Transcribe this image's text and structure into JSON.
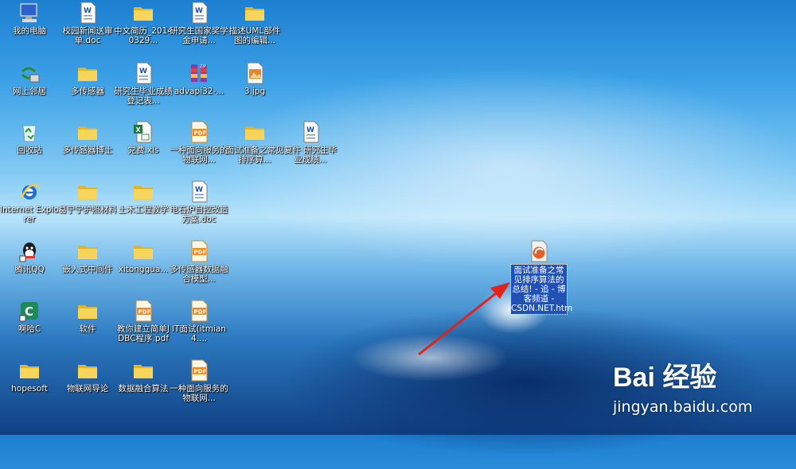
{
  "desktop": {
    "icons": [
      {
        "label": "我的电脑",
        "icon": "computer-icon"
      },
      {
        "label": "校园新闻送审单.doc",
        "icon": "word-doc-icon"
      },
      {
        "label": "中文简历_20140329...",
        "icon": "folder-icon"
      },
      {
        "label": "研究生国家奖学金申请...",
        "icon": "word-doc-icon"
      },
      {
        "label": "描述UML部件图的编辑...",
        "icon": "folder-icon"
      },
      {
        "label": "网上邻居",
        "icon": "network-icon"
      },
      {
        "label": "多传感器",
        "icon": "folder-icon"
      },
      {
        "label": "研究生毕业成绩登记表...",
        "icon": "word-doc-icon"
      },
      {
        "label": "advapi32-...",
        "icon": "winrar-icon"
      },
      {
        "label": "3.jpg",
        "icon": "image-icon"
      },
      {
        "label": "回收站",
        "icon": "recycle-bin-icon"
      },
      {
        "label": "多传感器博士",
        "icon": "folder-icon"
      },
      {
        "label": "党费.xls",
        "icon": "excel-icon"
      },
      {
        "label": "一种面向服务的物联网...",
        "icon": "pdf-icon"
      },
      {
        "label": "面试准备之常见排序算...",
        "icon": "folder-icon"
      },
      {
        "label": "复件 研究生毕业成绩...",
        "icon": "word-doc-icon"
      },
      {
        "label": "Internet Explorer",
        "icon": "ie-icon"
      },
      {
        "label": "葛宁宁护照材料",
        "icon": "folder-icon"
      },
      {
        "label": "土木工程教学",
        "icon": "folder-icon"
      },
      {
        "label": "电石炉自控改造方案.doc",
        "icon": "word-doc-icon"
      },
      {
        "label": "腾讯QQ",
        "icon": "qq-icon"
      },
      {
        "label": "嵌入式中间件",
        "icon": "folder-icon"
      },
      {
        "label": "xitonggua...",
        "icon": "folder-icon"
      },
      {
        "label": "多传感器数据融合模型...",
        "icon": "pdf-icon"
      },
      {
        "label": "啊哈C",
        "icon": "aha-c-icon"
      },
      {
        "label": "软件",
        "icon": "folder-icon"
      },
      {
        "label": "教你建立简单JDBC程序.pdf",
        "icon": "pdf-icon"
      },
      {
        "label": "IT面试(itmian4....",
        "icon": "pdf-icon"
      },
      {
        "label": "hopesoft",
        "icon": "folder-icon"
      },
      {
        "label": "物联网导论",
        "icon": "folder-icon"
      },
      {
        "label": "数据融合算法",
        "icon": "folder-icon"
      },
      {
        "label": "一种面向服务的物联网...",
        "icon": "pdf-icon"
      }
    ],
    "selected_icon": {
      "label": "面试准备之常见排序算法的总结! - 追 - 博客频道 - CSDN.NET.htm",
      "icon": "htm-file-icon"
    }
  },
  "watermark": {
    "logo": "Bai 经验",
    "url": "jingyan.baidu.com"
  },
  "colors": {
    "arrow": "#e2231a",
    "selection": "#2251b4",
    "folder": "#f3c63c"
  }
}
